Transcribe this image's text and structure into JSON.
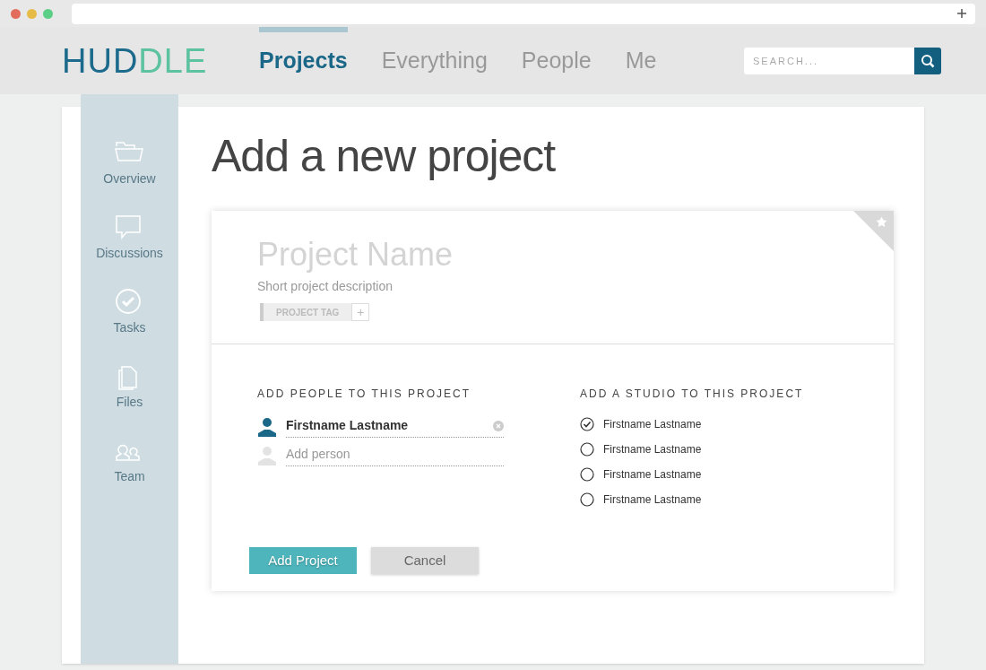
{
  "logo": {
    "parts": [
      "HUD",
      "DLE"
    ]
  },
  "nav": [
    {
      "label": "Projects",
      "selected": true
    },
    {
      "label": "Everything",
      "selected": false
    },
    {
      "label": "People",
      "selected": false
    },
    {
      "label": "Me",
      "selected": false
    }
  ],
  "search": {
    "placeholder": "SEARCH..."
  },
  "sidebar": {
    "items": [
      {
        "label": "Overview"
      },
      {
        "label": "Discussions"
      },
      {
        "label": "Tasks"
      },
      {
        "label": "Files"
      },
      {
        "label": "Team"
      }
    ]
  },
  "page_title": "Add a new project",
  "form": {
    "name_placeholder": "Project Name",
    "description_placeholder": "Short project description",
    "tag": "PROJECT TAG",
    "tag_add": "+",
    "people": {
      "heading": "ADD PEOPLE TO THIS PROJECT",
      "entries": [
        {
          "kind": "person",
          "text": "Firstname Lastname"
        },
        {
          "kind": "add",
          "placeholder": "Add person"
        }
      ]
    },
    "studios": {
      "heading": "ADD A STUDIO TO THIS PROJECT",
      "options": [
        {
          "label": "Firstname Lastname",
          "selected": true
        },
        {
          "label": "Firstname Lastname",
          "selected": false
        },
        {
          "label": "Firstname Lastname",
          "selected": false
        },
        {
          "label": "Firstname Lastname",
          "selected": false
        }
      ]
    },
    "buttons": [
      {
        "kind": "primary",
        "label": "Add Project"
      },
      {
        "kind": "secondary",
        "label": "Cancel"
      }
    ]
  }
}
